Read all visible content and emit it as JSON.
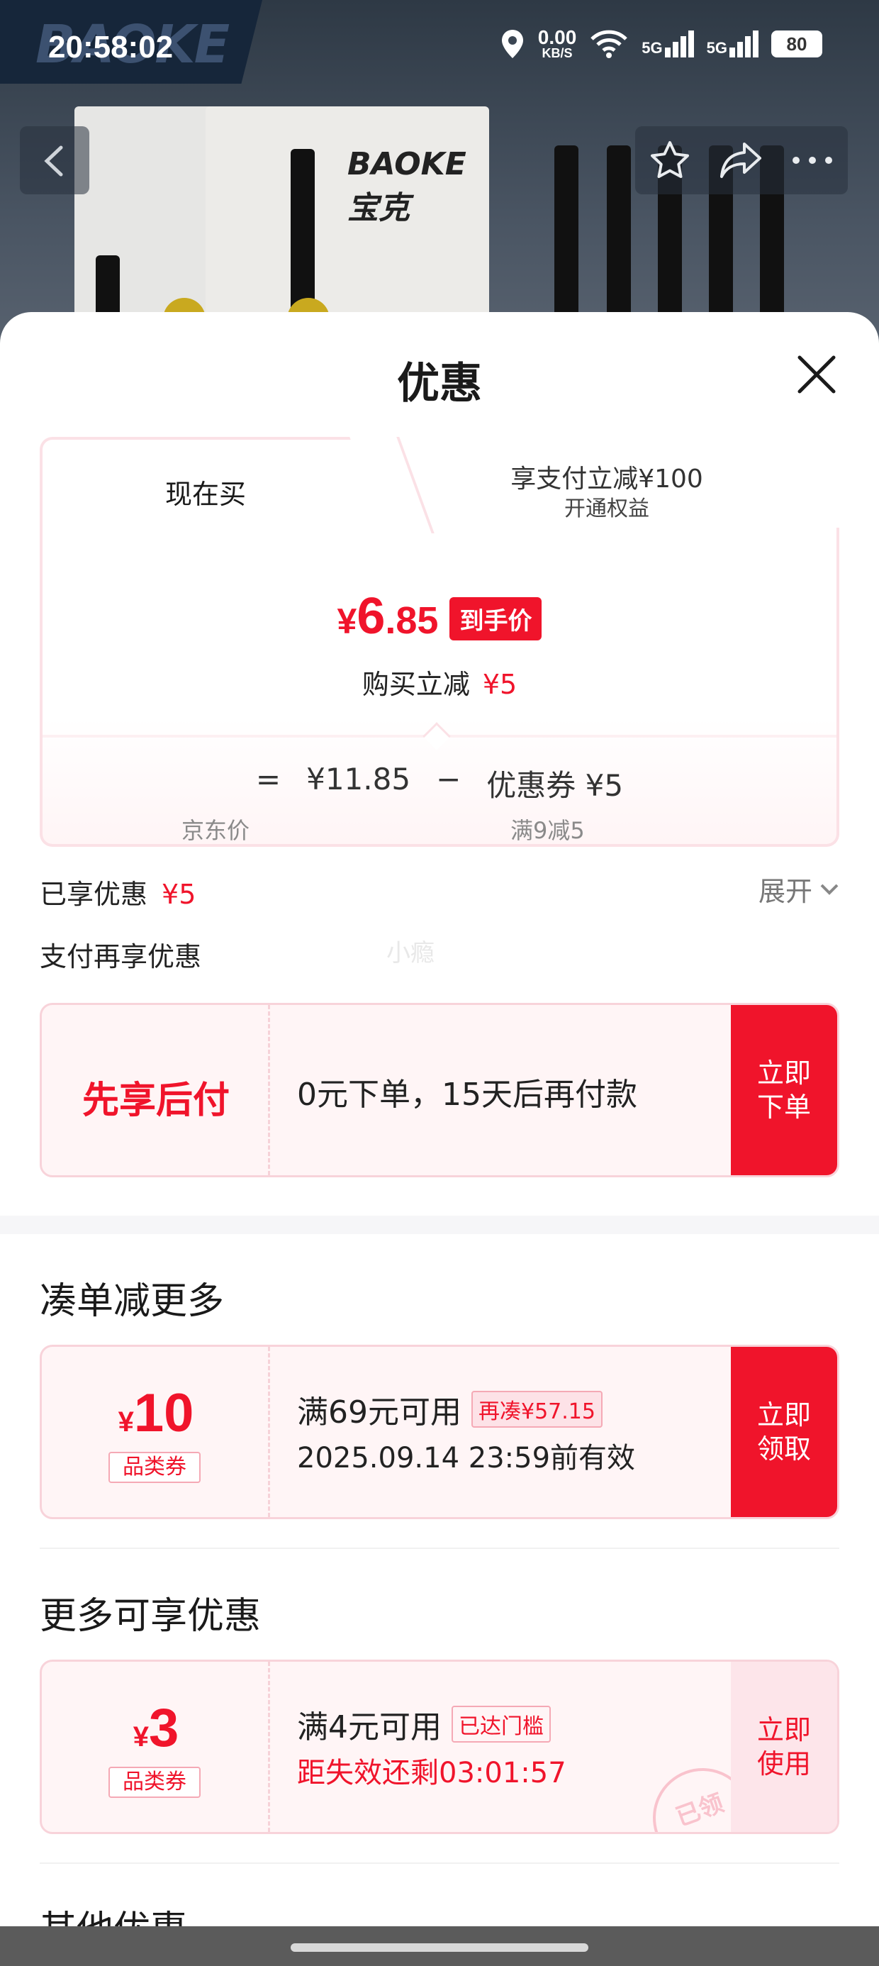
{
  "status_bar": {
    "time": "20:58:02",
    "net_speed": "0.00",
    "net_unit": "KB/S",
    "network1": "5G",
    "network2": "5G",
    "battery": "80"
  },
  "hero": {
    "brand_watermark": "BAOKE宝克",
    "box_brand": "BAOKE宝克"
  },
  "sheet": {
    "title": "优惠"
  },
  "price_card": {
    "tabs": [
      {
        "label": "现在买",
        "active": true
      },
      {
        "label": "享支付立减¥100",
        "sublabel": "开通权益",
        "active": false
      }
    ],
    "final_price_yen": "¥",
    "final_price_int": "6",
    "final_price_dec": ".85",
    "final_price_badge": "到手价",
    "instant_reduce_label": "购买立减",
    "instant_reduce_value": "¥5",
    "formula": {
      "equals": "=",
      "jd_price": "¥11.85",
      "minus": "−",
      "coupon": "优惠券 ¥5",
      "jd_price_label": "京东价",
      "coupon_label": "满9减5"
    }
  },
  "enjoyed": {
    "label": "已享优惠",
    "value": "¥5",
    "expand_label": "展开"
  },
  "pay_more": {
    "label": "支付再享优惠",
    "watermark": "小瘾"
  },
  "bnpl": {
    "title": "先享后付",
    "desc": "0元下单，15天后再付款",
    "button": "立即下单"
  },
  "section_more_order": {
    "title": "凑单减更多",
    "coupon": {
      "yen": "¥",
      "amount": "10",
      "type": "品类券",
      "condition": "满69元可用",
      "tag": "再凑¥57.15",
      "validity": "2025.09.14 23:59前有效",
      "button": "立即领取"
    }
  },
  "section_more_discounts": {
    "title": "更多可享优惠",
    "coupon": {
      "yen": "¥",
      "amount": "3",
      "type": "品类券",
      "condition": "满4元可用",
      "tag": "已达门槛",
      "validity": "距失效还剩03:01:57",
      "button": "立即使用",
      "stamp": "已领"
    }
  },
  "section_other": {
    "title": "其他优惠"
  },
  "colors": {
    "accent_red": "#f0142b",
    "coupon_border": "#f8d3da",
    "coupon_bg": "#fff5f6"
  }
}
